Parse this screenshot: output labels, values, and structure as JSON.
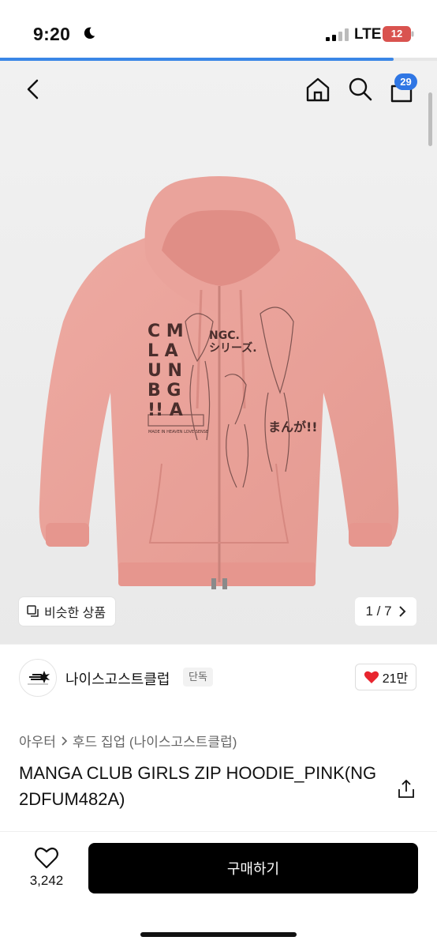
{
  "status_bar": {
    "time": "9:20",
    "network": "LTE",
    "battery": "12",
    "page_load_progress": 0.9
  },
  "nav": {
    "back_icon": "chevron-left-icon",
    "home_icon": "home-icon",
    "search_icon": "search-icon",
    "cart_icon": "cart-icon",
    "cart_count": "29"
  },
  "product_image": {
    "similar_items_label": "비슷한 상품",
    "pager": "1 / 7",
    "chest_text_left": "C M\nL A\nU N\nB G\n!! A",
    "chest_text_top": "NGC.\nシリーズ.",
    "chest_text_right": "まんが!!",
    "chest_logo": "MADE IN HEAVEN LOVE SENSE",
    "colors": {
      "hoodie": "#e9a29a",
      "background": "#efefef"
    }
  },
  "seller": {
    "name": "나이스고스트클럽",
    "exclusive_badge": "단독",
    "likes": "21만"
  },
  "breadcrumb": {
    "category": "아우터",
    "subcategory": "후드 집업 (나이스고스트클럽)"
  },
  "product": {
    "title": "MANGA CLUB GIRLS ZIP HOODIE_PINK(NG2DFUM482A)"
  },
  "bottom_bar": {
    "wish_count": "3,242",
    "buy_label": "구매하기"
  }
}
